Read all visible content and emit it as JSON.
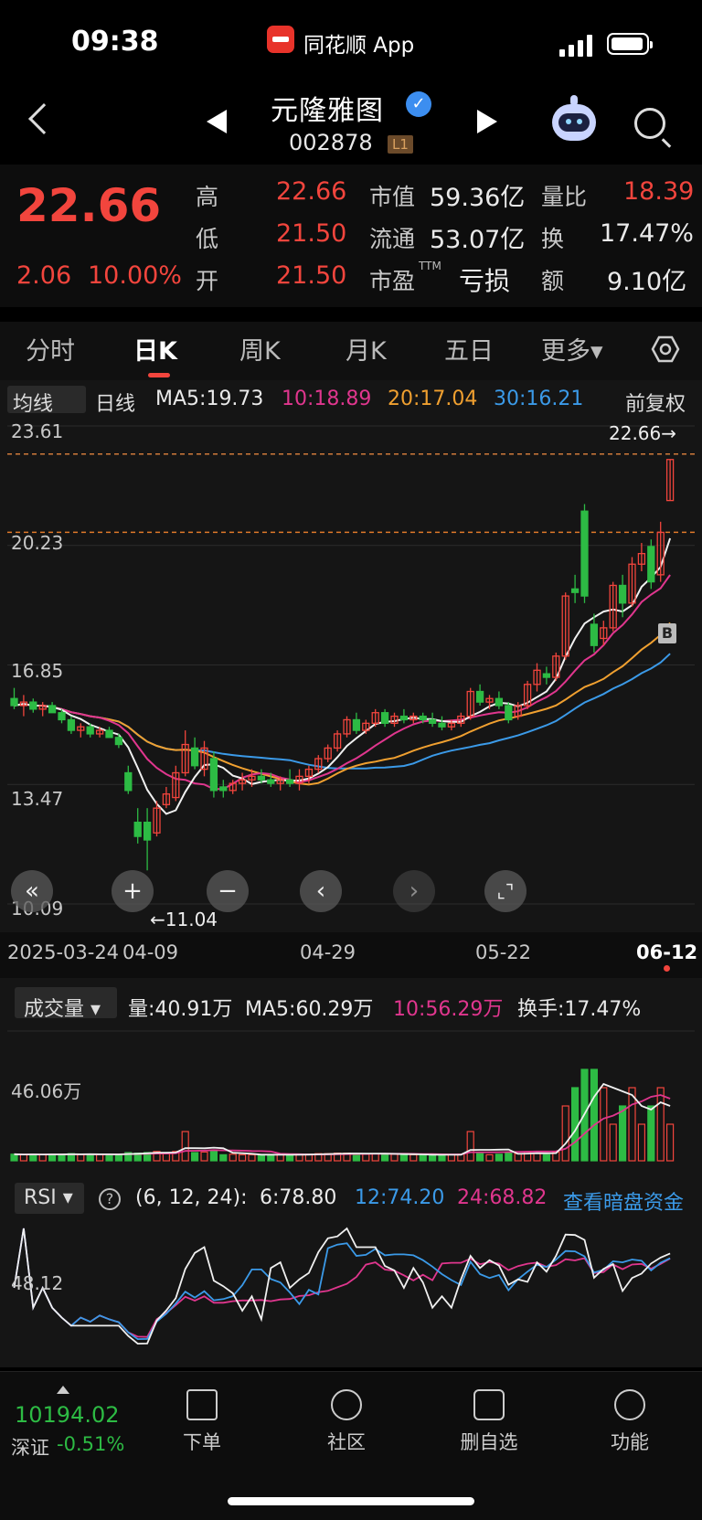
{
  "status_bar": {
    "time": "09:38",
    "app_name": "同花顺 App"
  },
  "header": {
    "stock_name": "元隆雅图",
    "stock_code": "002878",
    "level_badge": "L1"
  },
  "quote": {
    "last_price": "22.66",
    "change_amount": "2.06",
    "change_percent": "10.00%",
    "high_label": "高",
    "high": "22.66",
    "low_label": "低",
    "low": "21.50",
    "open_label": "开",
    "open": "21.50",
    "mktcap_label": "市值",
    "mktcap": "59.36亿",
    "float_label": "流通",
    "float_cap": "53.07亿",
    "pe_label": "市盈",
    "pe_sup": "TTM",
    "pe": "亏损",
    "volratio_label": "量比",
    "volratio": "18.39",
    "turnover_label": "换",
    "turnover": "17.47%",
    "amount_label": "额",
    "amount": "9.10亿"
  },
  "tabs": [
    "分时",
    "日K",
    "周K",
    "月K",
    "五日",
    "更多▾"
  ],
  "active_tab": "日K",
  "ma_bar": {
    "selector": "均线",
    "period": "日线",
    "ma5": "MA5:19.73",
    "ma10": "10:18.89",
    "ma20": "20:17.04",
    "ma30": "30:16.21",
    "adjust": "前复权"
  },
  "kline": {
    "y_labels": [
      "23.61",
      "20.23",
      "16.85",
      "13.47",
      "10.09"
    ],
    "last_marker": "22.66→",
    "min_marker": "←11.04",
    "buy_badge": "B",
    "dates": [
      "2025-03-24",
      "04-09",
      "04-29",
      "05-22",
      "06-12"
    ]
  },
  "volume": {
    "selector": "成交量 ▾",
    "vol": "量:40.91万",
    "ma5": "MA5:60.29万",
    "ma10": "10:56.29万",
    "turnover": "换手:17.47%",
    "y_label": "46.06万"
  },
  "rsi": {
    "selector": "RSI ▾",
    "help": "?",
    "params": "(6, 12, 24):",
    "rsi6": "6:78.80",
    "rsi12": "12:74.20",
    "rsi24": "24:68.82",
    "link": "查看暗盘资金",
    "y_label": "48.12"
  },
  "bottom_nav": {
    "index_value": "10194.02",
    "index_name": "深证",
    "index_change": "-0.51%",
    "items": [
      "下单",
      "社区",
      "删自选",
      "功能"
    ]
  },
  "chart_data": {
    "type": "candlestick",
    "price_axis": {
      "ylim": [
        10.09,
        23.61
      ],
      "ticks": [
        23.61,
        20.23,
        16.85,
        13.47,
        10.09
      ]
    },
    "candles": [
      [
        15.9,
        16.2,
        15.6,
        15.7
      ],
      [
        15.7,
        16.0,
        15.4,
        15.8
      ],
      [
        15.8,
        15.9,
        15.5,
        15.6
      ],
      [
        15.6,
        15.8,
        15.4,
        15.7
      ],
      [
        15.7,
        15.8,
        15.5,
        15.5
      ],
      [
        15.5,
        15.6,
        15.2,
        15.3
      ],
      [
        15.3,
        15.4,
        14.9,
        15.0
      ],
      [
        15.0,
        15.2,
        14.8,
        15.1
      ],
      [
        15.1,
        15.2,
        14.8,
        14.9
      ],
      [
        14.9,
        15.1,
        14.8,
        15.0
      ],
      [
        15.0,
        15.1,
        14.8,
        14.8
      ],
      [
        14.8,
        14.9,
        14.5,
        14.6
      ],
      [
        13.8,
        14.0,
        13.2,
        13.3
      ],
      [
        12.4,
        12.8,
        11.8,
        12.0
      ],
      [
        12.4,
        12.8,
        11.04,
        11.9
      ],
      [
        12.1,
        13.0,
        12.0,
        12.8
      ],
      [
        12.9,
        13.4,
        12.8,
        13.2
      ],
      [
        13.1,
        14.0,
        13.0,
        13.8
      ],
      [
        13.8,
        15.0,
        13.7,
        14.6
      ],
      [
        14.5,
        14.8,
        13.9,
        14.0
      ],
      [
        13.9,
        14.7,
        13.7,
        14.5
      ],
      [
        14.2,
        14.4,
        13.1,
        13.3
      ],
      [
        13.4,
        13.6,
        13.1,
        13.3
      ],
      [
        13.3,
        13.6,
        13.2,
        13.5
      ],
      [
        13.5,
        13.8,
        13.3,
        13.6
      ],
      [
        13.6,
        13.9,
        13.4,
        13.7
      ],
      [
        13.7,
        13.9,
        13.5,
        13.6
      ],
      [
        13.6,
        13.8,
        13.4,
        13.5
      ],
      [
        13.5,
        13.7,
        13.3,
        13.6
      ],
      [
        13.6,
        13.9,
        13.4,
        13.5
      ],
      [
        13.5,
        13.9,
        13.3,
        13.7
      ],
      [
        13.7,
        14.0,
        13.5,
        13.9
      ],
      [
        13.9,
        14.3,
        13.8,
        14.2
      ],
      [
        14.2,
        14.6,
        14.1,
        14.5
      ],
      [
        14.5,
        15.0,
        14.4,
        14.9
      ],
      [
        14.9,
        15.4,
        14.8,
        15.3
      ],
      [
        15.3,
        15.5,
        14.9,
        15.0
      ],
      [
        15.0,
        15.3,
        14.9,
        15.2
      ],
      [
        15.2,
        15.6,
        15.1,
        15.5
      ],
      [
        15.5,
        15.6,
        15.1,
        15.2
      ],
      [
        15.2,
        15.5,
        15.1,
        15.4
      ],
      [
        15.4,
        15.6,
        15.2,
        15.3
      ],
      [
        15.3,
        15.5,
        15.2,
        15.4
      ],
      [
        15.4,
        15.5,
        15.2,
        15.3
      ],
      [
        15.3,
        15.5,
        15.1,
        15.2
      ],
      [
        15.2,
        15.4,
        15.0,
        15.1
      ],
      [
        15.1,
        15.3,
        15.0,
        15.2
      ],
      [
        15.2,
        15.5,
        15.1,
        15.4
      ],
      [
        15.4,
        16.2,
        15.3,
        16.1
      ],
      [
        16.1,
        16.3,
        15.7,
        15.8
      ],
      [
        15.8,
        16.0,
        15.6,
        15.9
      ],
      [
        15.9,
        16.1,
        15.6,
        15.7
      ],
      [
        15.7,
        15.8,
        15.2,
        15.3
      ],
      [
        15.4,
        15.8,
        15.3,
        15.7
      ],
      [
        15.7,
        16.4,
        15.6,
        16.3
      ],
      [
        16.3,
        16.9,
        16.1,
        16.7
      ],
      [
        16.6,
        16.8,
        16.3,
        16.5
      ],
      [
        16.5,
        17.2,
        16.4,
        17.1
      ],
      [
        17.1,
        18.9,
        17.0,
        18.8
      ],
      [
        19.0,
        19.4,
        18.6,
        18.9
      ],
      [
        21.2,
        21.4,
        18.6,
        18.8
      ],
      [
        18.0,
        18.3,
        17.2,
        17.4
      ],
      [
        17.6,
        18.1,
        17.4,
        17.9
      ],
      [
        17.9,
        19.2,
        17.8,
        19.1
      ],
      [
        19.1,
        19.4,
        18.2,
        18.6
      ],
      [
        18.6,
        19.9,
        18.5,
        19.7
      ],
      [
        19.7,
        20.3,
        19.5,
        20.0
      ],
      [
        20.2,
        20.4,
        19.0,
        19.2
      ],
      [
        19.4,
        20.9,
        19.2,
        20.6
      ],
      [
        21.5,
        22.66,
        21.5,
        22.66
      ]
    ]
  }
}
